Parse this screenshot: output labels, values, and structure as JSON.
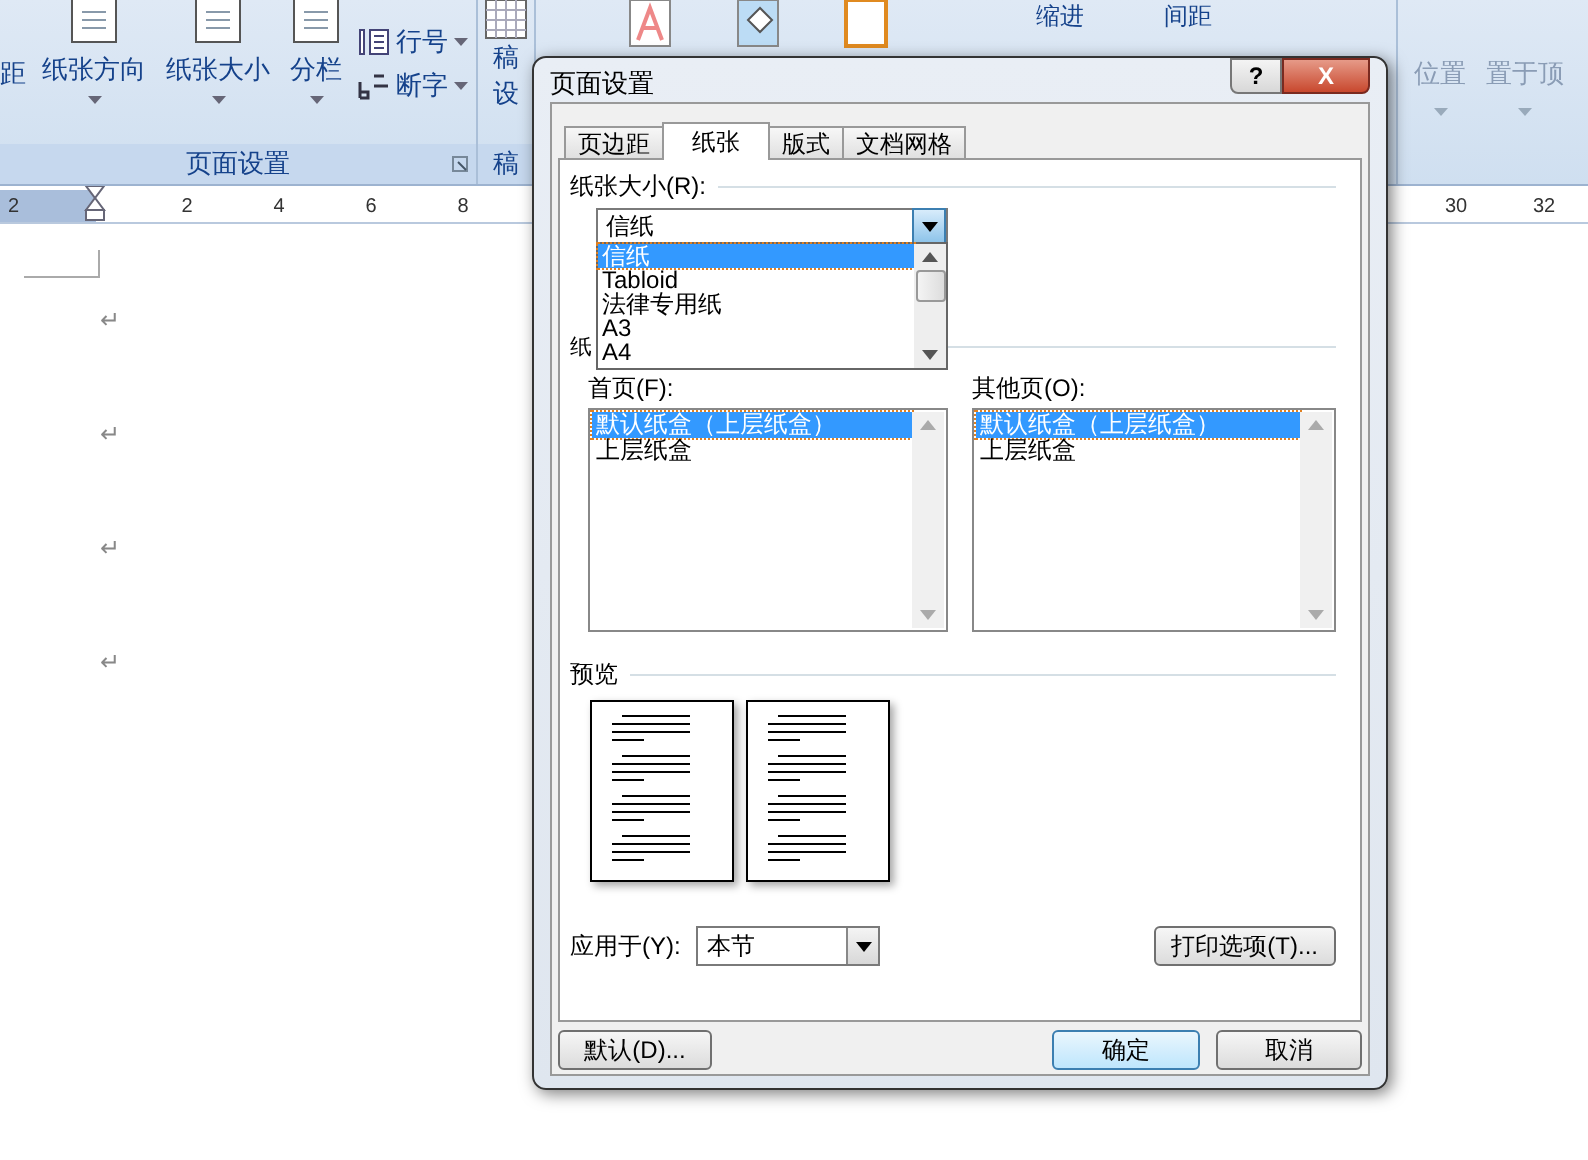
{
  "ribbon": {
    "cut_label": "距",
    "large_buttons": [
      "纸张方向",
      "纸张大小",
      "分栏"
    ],
    "small_buttons": [
      {
        "label": "行号",
        "kind": "line-numbers"
      },
      {
        "label": "断字",
        "kind": "hyphenation"
      }
    ],
    "group_label": "页面设置",
    "next_group_texts": [
      "稿",
      "设"
    ],
    "next_group_label": "稿",
    "indent_label": "缩进",
    "spacing_label": "间距",
    "arrange_buttons": [
      "位置",
      "置于顶"
    ]
  },
  "ruler": {
    "left_numbers": [
      "2",
      "2",
      "4",
      "6",
      "8"
    ],
    "right_numbers": [
      "30",
      "32"
    ]
  },
  "document": {
    "paragraph_marks": [
      "↵",
      "↵",
      "↵",
      "↵"
    ]
  },
  "dialog": {
    "title": "页面设置",
    "help": "?",
    "close": "X",
    "tabs": [
      {
        "label": "页边距",
        "selected": false
      },
      {
        "label": "纸张",
        "selected": true
      },
      {
        "label": "版式",
        "selected": false
      },
      {
        "label": "文档网格",
        "selected": false
      }
    ],
    "paper_size": {
      "label": "纸张大小(R):",
      "value": "信纸",
      "expanded": true,
      "options": [
        {
          "label": "信纸",
          "selected": true
        },
        {
          "label": "Tabloid",
          "selected": false
        },
        {
          "label": "法律专用纸",
          "selected": false
        },
        {
          "label": "A3",
          "selected": false
        },
        {
          "label": "A4",
          "selected": false
        }
      ]
    },
    "paper_source_label": "纸",
    "first_page": {
      "label": "首页(F):",
      "items": [
        {
          "label": "默认纸盒（上层纸盒）",
          "selected": true
        },
        {
          "label": "上层纸盒",
          "selected": false
        }
      ]
    },
    "other_pages": {
      "label": "其他页(O):",
      "items": [
        {
          "label": "默认纸盒（上层纸盒）",
          "selected": true
        },
        {
          "label": "上层纸盒",
          "selected": false
        }
      ]
    },
    "preview_label": "预览",
    "apply_to": {
      "label": "应用于(Y):",
      "value": "本节"
    },
    "print_options": "打印选项(T)...",
    "default_button": "默认(D)...",
    "ok": "确定",
    "cancel": "取消"
  }
}
